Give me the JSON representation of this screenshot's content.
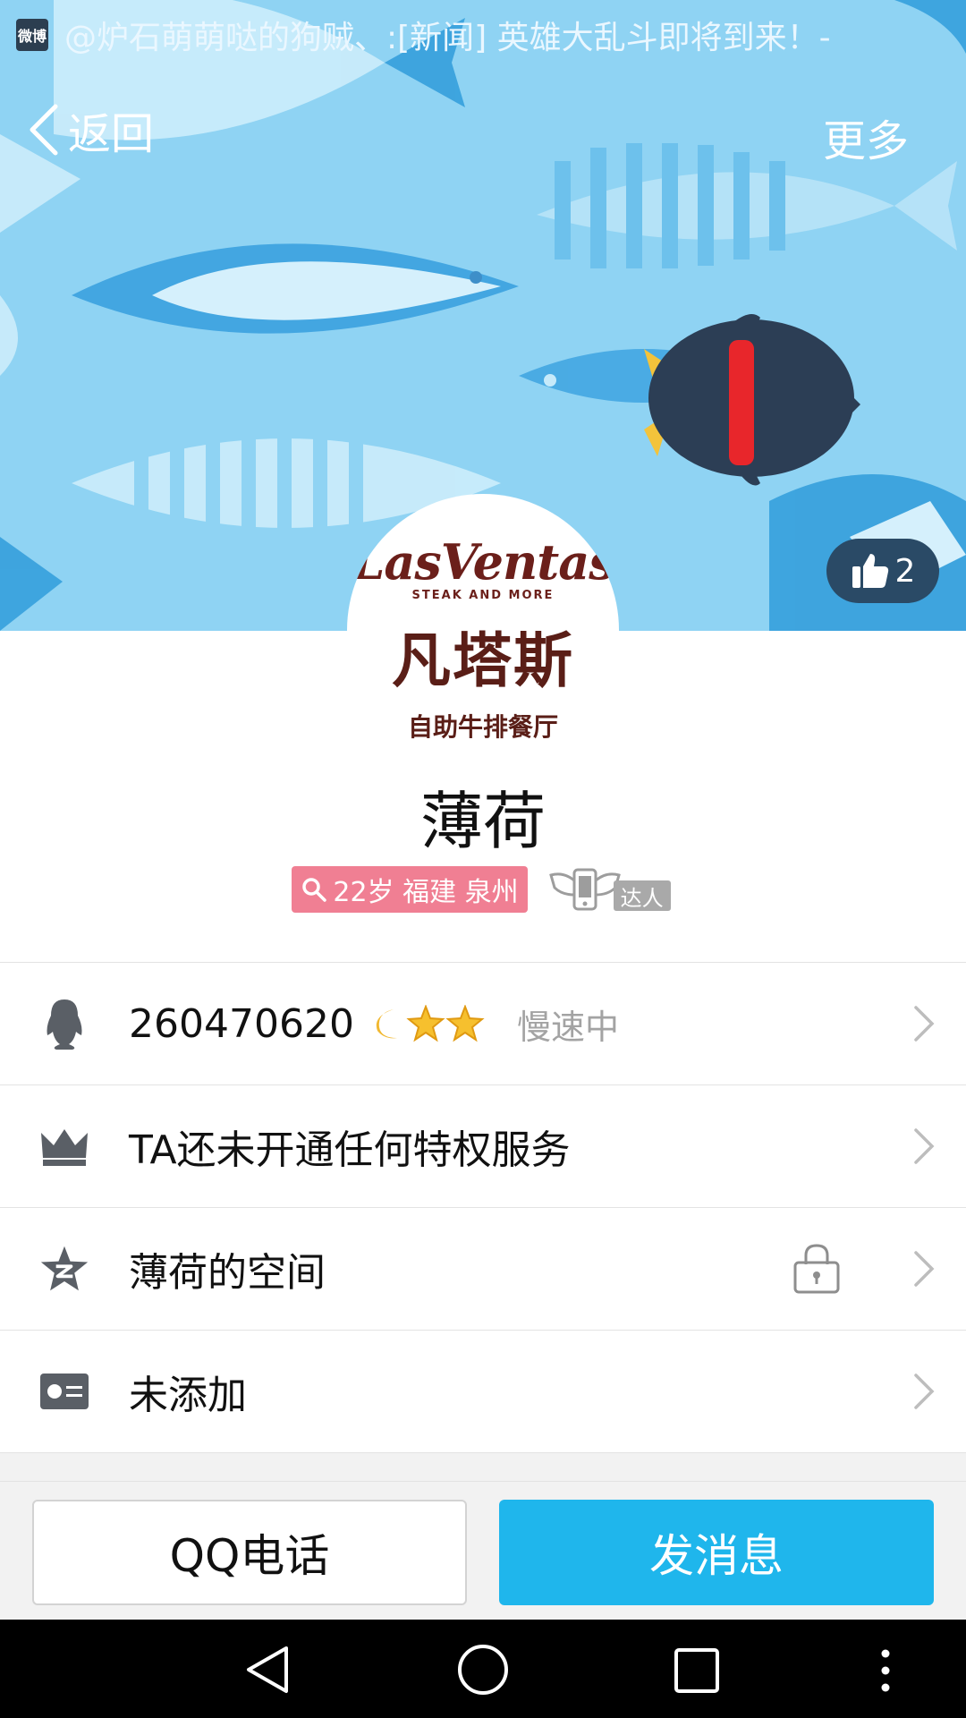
{
  "status_bar": {
    "app_icon": "weibo-icon",
    "notification_text": "@炉石萌萌哒的狗贼、:[新闻] 英雄大乱斗即将到来！-"
  },
  "nav": {
    "back_label": "返回",
    "more_label": "更多"
  },
  "like": {
    "icon": "thumbs-up-icon",
    "count": "2"
  },
  "avatar": {
    "brand_en": "LasVentas",
    "brand_tagline": "STEAK AND MORE",
    "brand_cn": "凡塔斯",
    "brand_desc": "自助牛排餐厅"
  },
  "profile": {
    "name": "薄荷",
    "info_tag": "22岁 福建 泉州",
    "talent_badge": "达人"
  },
  "list": {
    "qq_row": {
      "icon": "penguin-icon",
      "qq_number": "260470620",
      "level_icons": [
        "moon-icon",
        "star-icon",
        "star-icon"
      ],
      "status": "慢速中"
    },
    "privilege_row": {
      "icon": "crown-icon",
      "label": "TA还未开通任何特权服务"
    },
    "space_row": {
      "icon": "qzone-star-icon",
      "label": "薄荷的空间",
      "lock_icon": "lock-icon"
    },
    "card_row": {
      "icon": "id-card-icon",
      "label": "未添加"
    }
  },
  "actions": {
    "call_label": "QQ电话",
    "message_label": "发消息"
  },
  "colors": {
    "accent": "#1fb6ec",
    "tag_pink": "#f07f93",
    "header_sky": "#8ed1f1",
    "like_bg": "#2a4a66"
  }
}
